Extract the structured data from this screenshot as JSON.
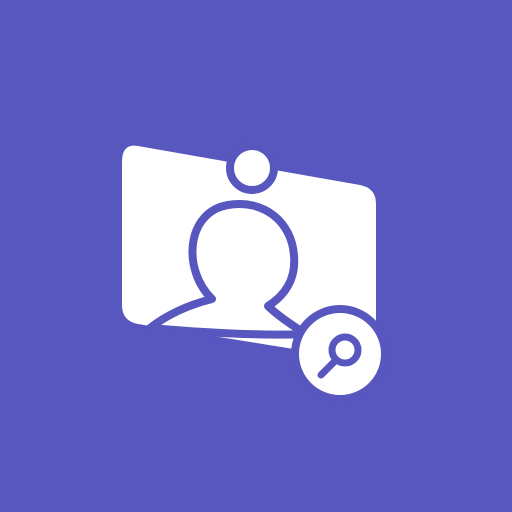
{
  "icon": {
    "name": "person-search-app-icon",
    "glyphs": [
      "tilted-card-icon",
      "user-silhouette-icon",
      "magnifier-icon"
    ]
  },
  "colors": {
    "background": "#5757BF",
    "foreground": "#FFFFFF"
  }
}
